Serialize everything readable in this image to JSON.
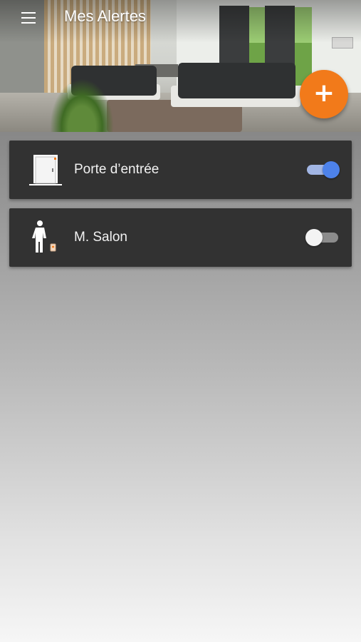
{
  "appbar": {
    "title": "Mes Alertes"
  },
  "fab": {
    "icon": "plus-icon",
    "color": "#f27a1a"
  },
  "alerts": [
    {
      "label": "Porte d’entrée",
      "icon": "door-icon",
      "enabled": true
    },
    {
      "label": "M. Salon",
      "icon": "motion-sensor-person-icon",
      "enabled": false
    }
  ],
  "colors": {
    "card": "#323232",
    "toggle_on": "#4d82ea",
    "accent": "#f27a1a"
  }
}
